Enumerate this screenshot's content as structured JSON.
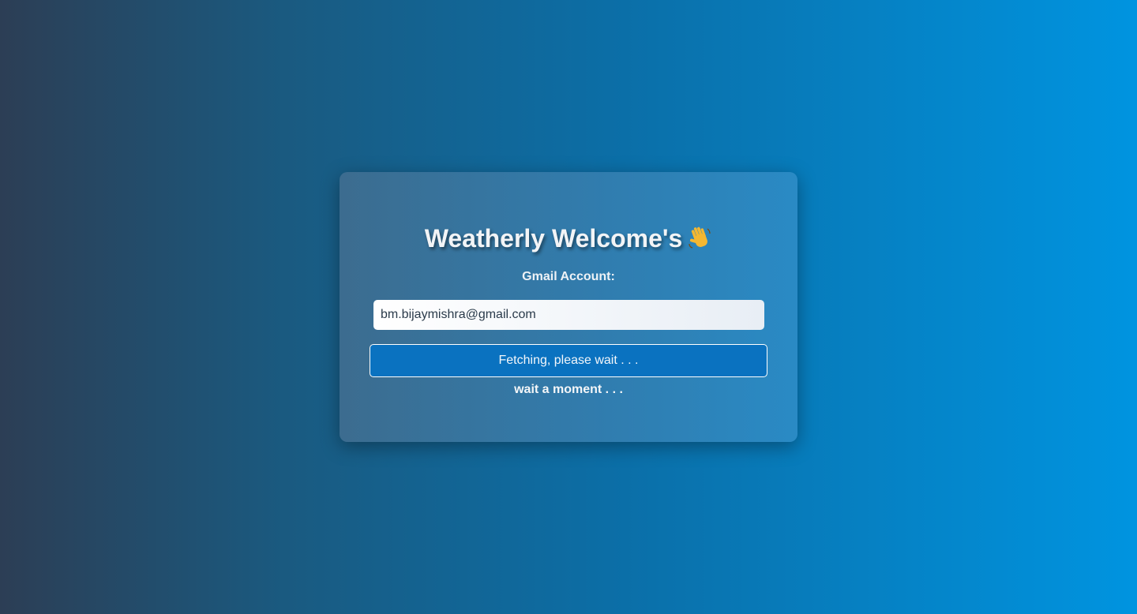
{
  "card": {
    "title": "Weatherly Welcome's",
    "title_icon": "waving-hand-icon",
    "email_label": "Gmail Account:",
    "email_value": "bm.bijaymishra@gmail.com",
    "submit_label": "Fetching, please wait . . .",
    "status_text": "wait a moment . . ."
  },
  "colors": {
    "background_start": "#2c3e55",
    "background_end": "#0094e0",
    "button": "#0a72c0"
  }
}
